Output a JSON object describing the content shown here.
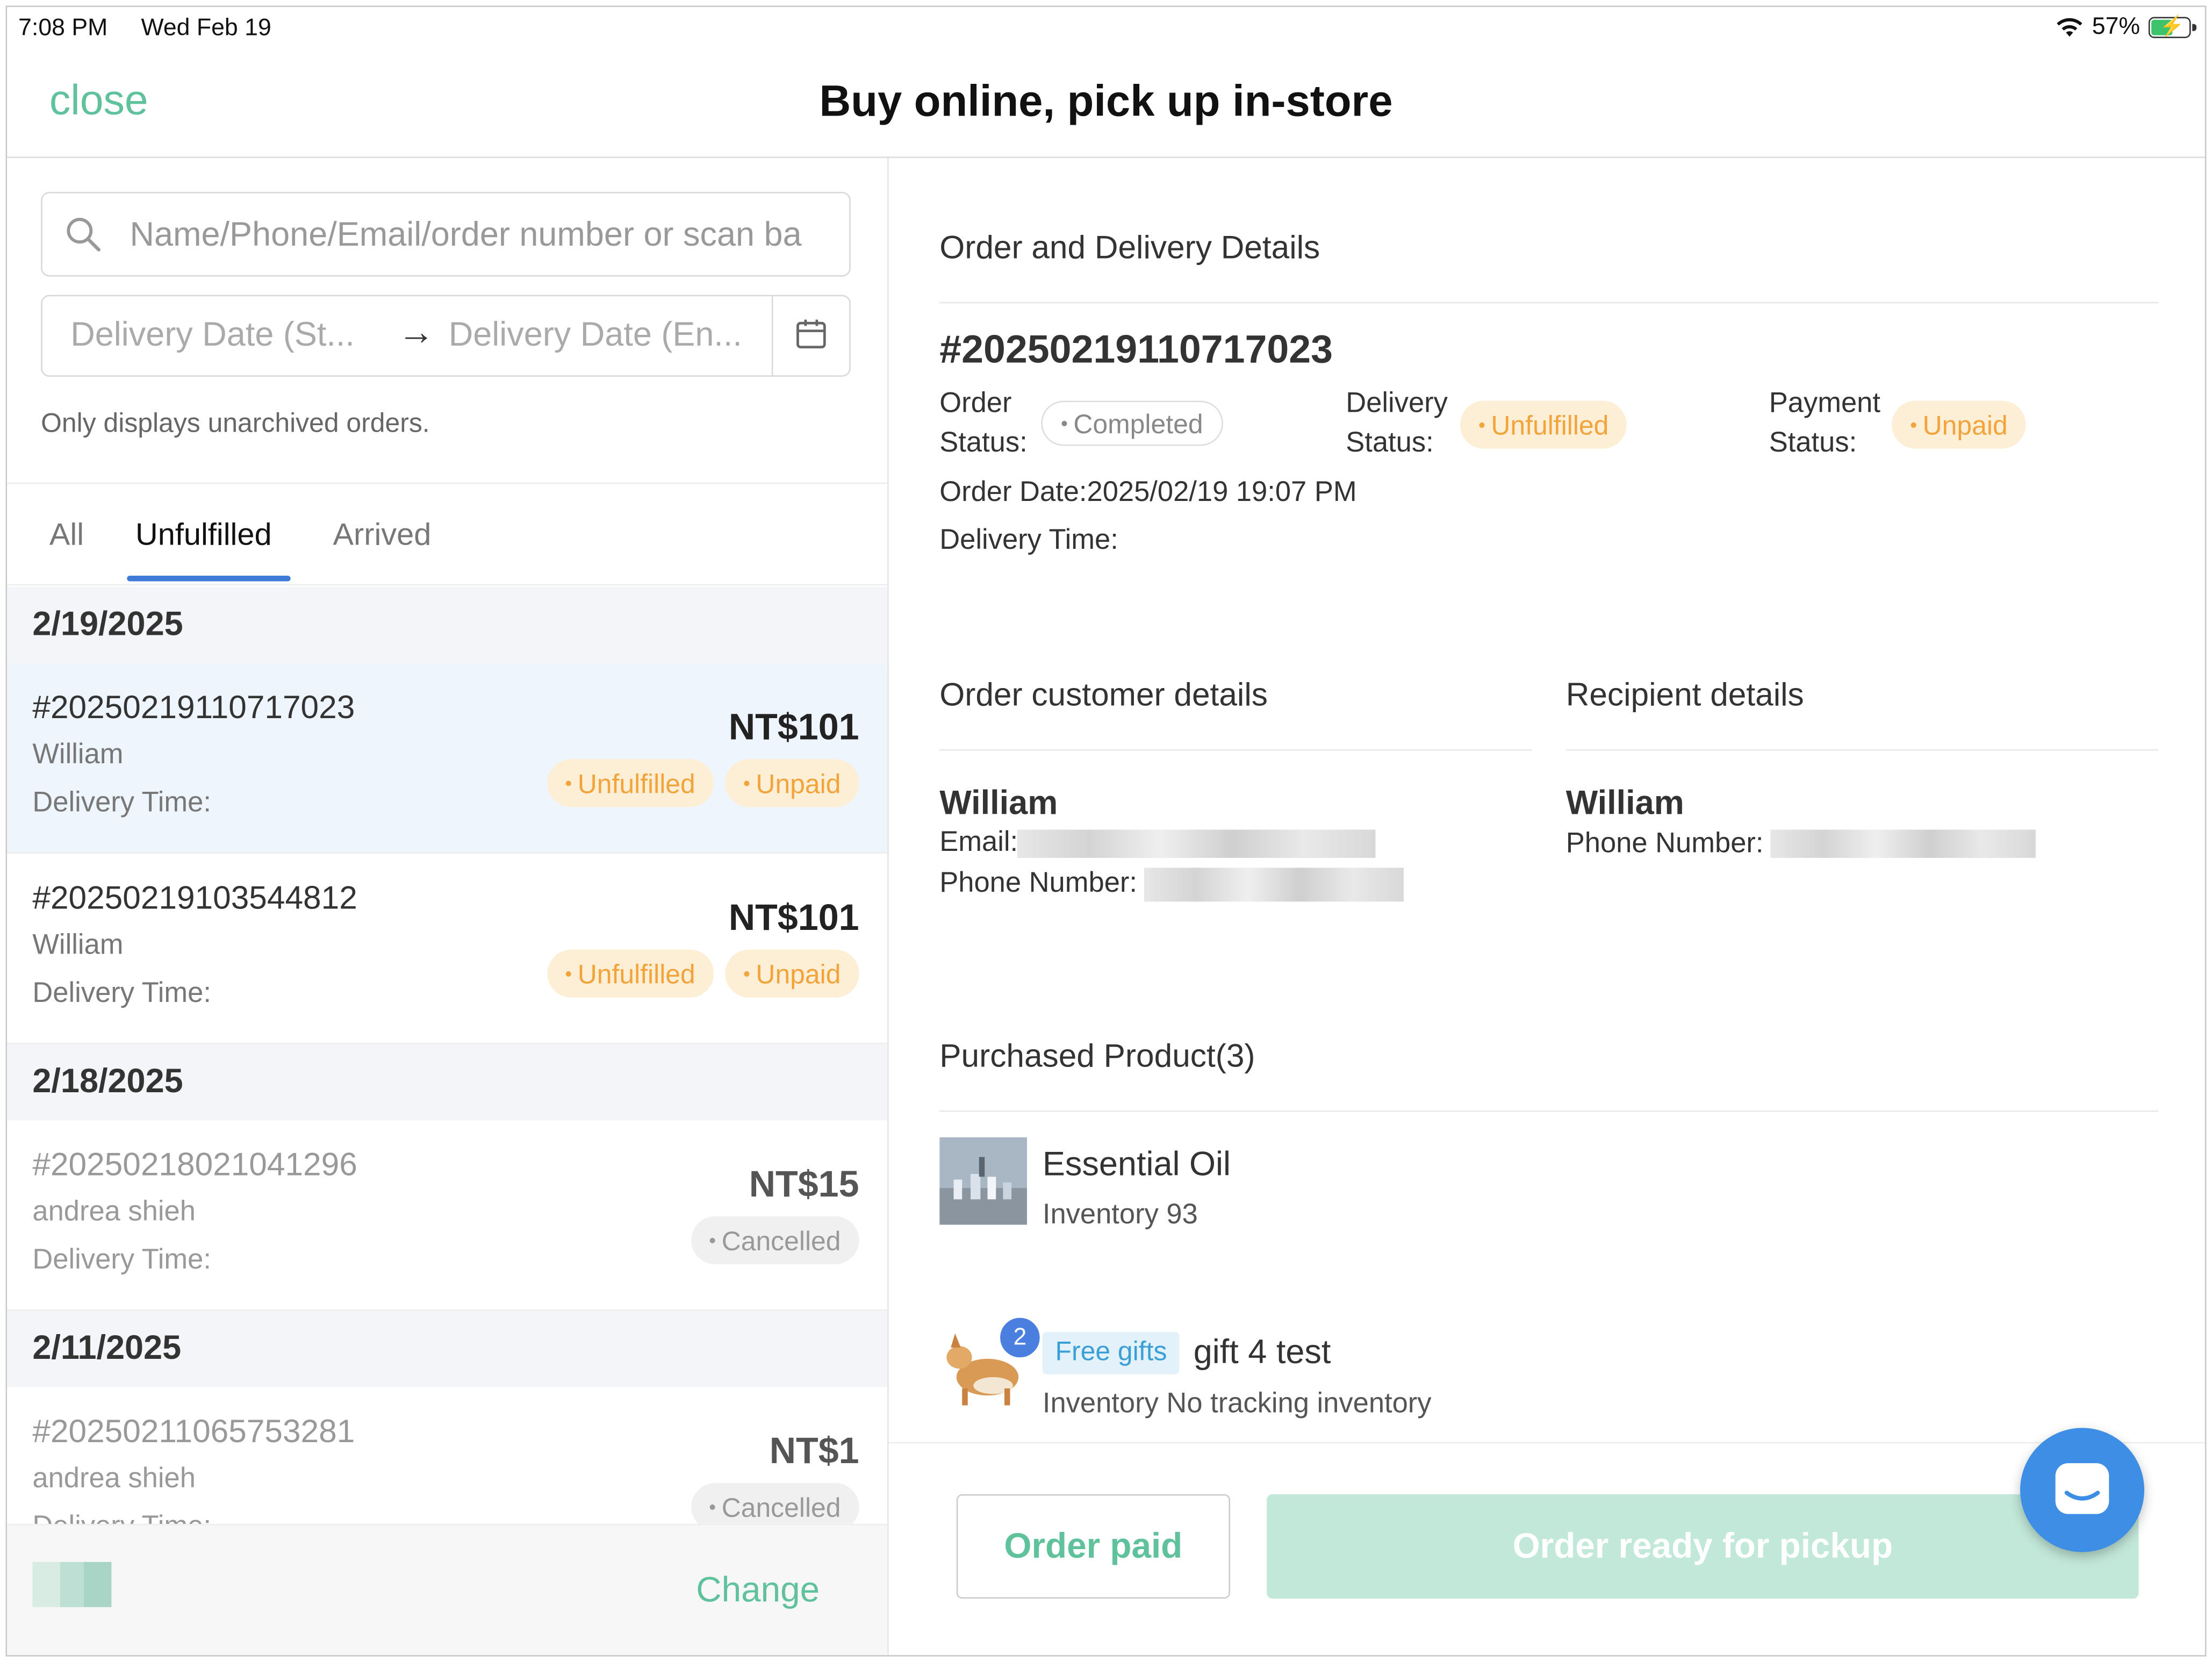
{
  "status_bar": {
    "time": "7:08 PM",
    "date": "Wed Feb 19",
    "battery": "57%"
  },
  "header": {
    "close_label": "close",
    "title": "Buy online, pick up in-store"
  },
  "filters": {
    "search_placeholder": "Name/Phone/Email/order number or scan ba",
    "date_start_placeholder": "Delivery Date (St...",
    "date_end_placeholder": "Delivery Date (En...",
    "hint": "Only displays unarchived orders."
  },
  "tabs": [
    "All",
    "Unfulfilled",
    "Arrived"
  ],
  "active_tab": "Unfulfilled",
  "order_groups": [
    {
      "date": "2/19/2025",
      "orders": [
        {
          "number": "#20250219110717023",
          "customer": "William",
          "delivery_label": "Delivery Time:",
          "price": "NT$101",
          "badges": [
            "Unfulfilled",
            "Unpaid"
          ]
        },
        {
          "number": "#20250219103544812",
          "customer": "William",
          "delivery_label": "Delivery Time:",
          "price": "NT$101",
          "badges": [
            "Unfulfilled",
            "Unpaid"
          ]
        }
      ]
    },
    {
      "date": "2/18/2025",
      "orders": [
        {
          "number": "#20250218021041296",
          "customer": "andrea shieh",
          "delivery_label": "Delivery Time:",
          "price": "NT$15",
          "badges": [
            "Cancelled"
          ]
        }
      ]
    },
    {
      "date": "2/11/2025",
      "orders": [
        {
          "number": "#20250211065753281",
          "customer": "andrea shieh",
          "delivery_label": "Delivery Time:",
          "price": "NT$1",
          "badges": [
            "Cancelled"
          ]
        }
      ]
    }
  ],
  "left_footer": {
    "change_label": "Change"
  },
  "details": {
    "section_title": "Order and Delivery Details",
    "order_number": "#20250219110717023",
    "order_status_label": [
      "Order",
      "Status:"
    ],
    "order_status": "Completed",
    "delivery_status_label": [
      "Delivery",
      "Status:"
    ],
    "delivery_status": "Unfulfilled",
    "payment_status_label": [
      "Payment",
      "Status:"
    ],
    "payment_status": "Unpaid",
    "order_date": "Order Date:2025/02/19 19:07 PM",
    "delivery_time": "Delivery Time:"
  },
  "customer": {
    "title": "Order customer details",
    "name": "William",
    "email_label": "Email:",
    "phone_label": "Phone Number:"
  },
  "recipient": {
    "title": "Recipient details",
    "name": "William",
    "phone_label": "Phone Number:"
  },
  "products": {
    "title": "Purchased Product(3)",
    "items": [
      {
        "name": "Essential Oil",
        "inventory": "Inventory 93"
      },
      {
        "tag": "Free gifts",
        "name": "gift 4 test",
        "inventory": "Inventory No tracking inventory",
        "quantity": "2"
      }
    ]
  },
  "actions": {
    "paid_label": "Order paid",
    "ready_label": "Order ready for pickup"
  },
  "colors": {
    "accent_green": "#5fc29c",
    "tab_blue": "#3e7bd8",
    "warn": "#f2a33a",
    "chat_blue": "#3d8ee4"
  }
}
